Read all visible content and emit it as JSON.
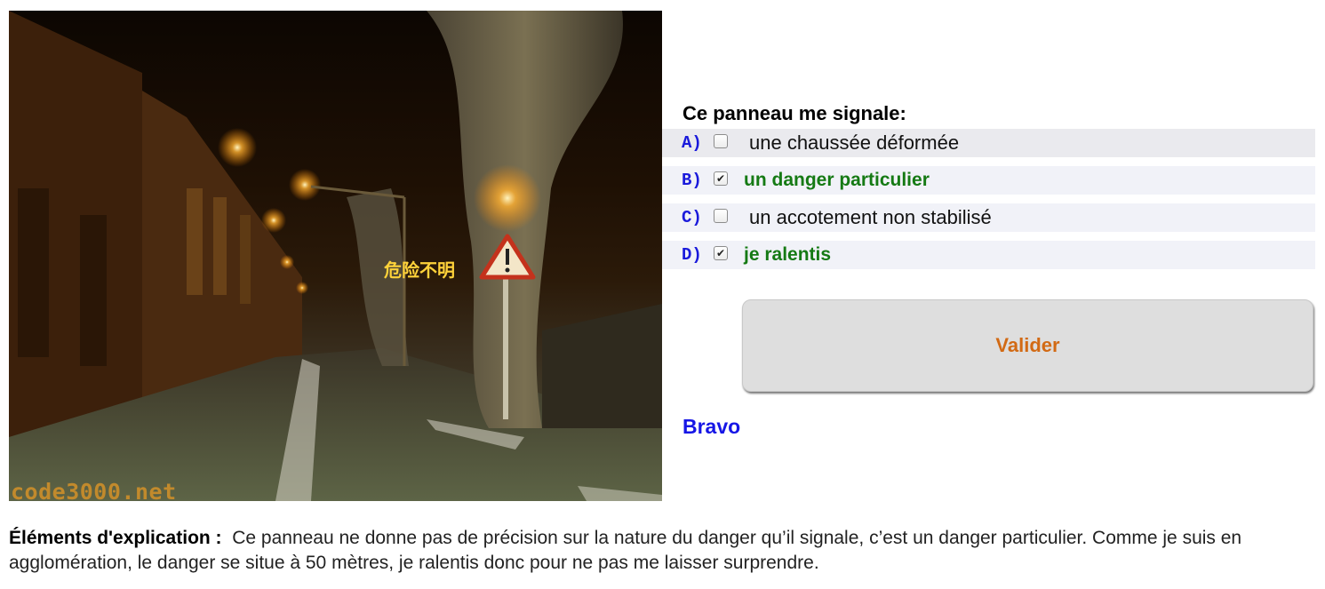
{
  "photo": {
    "caption": "危险不明",
    "watermark": "code3000.net"
  },
  "question": {
    "title": "Ce panneau me signale:",
    "answers": [
      {
        "letter": "A)",
        "text": "une chaussée déformée",
        "checked": false,
        "mark": ""
      },
      {
        "letter": "B)",
        "text": "un danger particulier",
        "checked": true,
        "mark": "✔"
      },
      {
        "letter": "C)",
        "text": "un accotement non stabilisé",
        "checked": false,
        "mark": ""
      },
      {
        "letter": "D)",
        "text": "je ralentis",
        "checked": true,
        "mark": "✔"
      }
    ]
  },
  "validate_label": "Valider",
  "result": "Bravo",
  "explanation": {
    "label": "Éléments d'explication :",
    "text": "Ce panneau ne donne pas de précision sur la nature du danger qu’il signale, c’est un danger particulier. Comme je suis en agglomération, le danger se situe à 50 mètres, je ralentis donc pour ne pas me laisser surprendre."
  },
  "colors": {
    "letter": "#1a1adb",
    "correct": "#157a14",
    "validate": "#d26a14",
    "result": "#1616e6"
  }
}
